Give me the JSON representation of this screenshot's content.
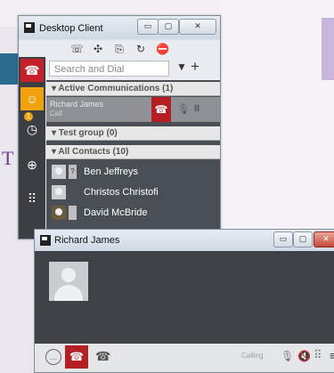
{
  "desktop_client": {
    "title": "Desktop Client",
    "window_controls": {
      "min": "▭",
      "max": "▢",
      "close": "✕"
    },
    "toolbar_icons": [
      "call-forward-icon",
      "transfer-icon",
      "conference-icon",
      "callback-icon",
      "dnd-icon"
    ],
    "toolbar_glyphs": [
      "☏",
      "✣",
      "⎘",
      "↻",
      "⛔"
    ],
    "sidebar": {
      "phone_glyph": "☎",
      "contacts_glyph": "☺",
      "history_glyph": "◷",
      "history_badge": "1",
      "globe_glyph": "⊕",
      "dialpad_glyph": "⠿"
    },
    "search_placeholder": "Search and Dial",
    "filter_glyph": "▼",
    "add_glyph": "+",
    "groups": {
      "active": "▾ Active Communications (1)",
      "test": "▾ Test group (0)",
      "all": "▾ All Contacts (10)"
    },
    "active_call": {
      "name": "Richard James",
      "status": "Call",
      "hangup_glyph": "☎",
      "mute_glyph": "🎙",
      "hold_glyph": "II"
    },
    "contacts": [
      {
        "name": "Ben Jeffreys",
        "presence": "?"
      },
      {
        "name": "Christos Christofi",
        "presence": ""
      },
      {
        "name": "David McBride",
        "presence": ""
      }
    ]
  },
  "call_window": {
    "title": "Richard James",
    "window_controls": {
      "min": "▭",
      "max": "▢",
      "close": "✕"
    },
    "status": "Calling",
    "chat_glyph": "…",
    "hangup_glyph": "☎",
    "phone_glyph": "☎",
    "mute_glyph": "🎙",
    "speaker_glyph": "🔇",
    "dialpad_glyph": "⠿",
    "more_glyph": "≡"
  }
}
